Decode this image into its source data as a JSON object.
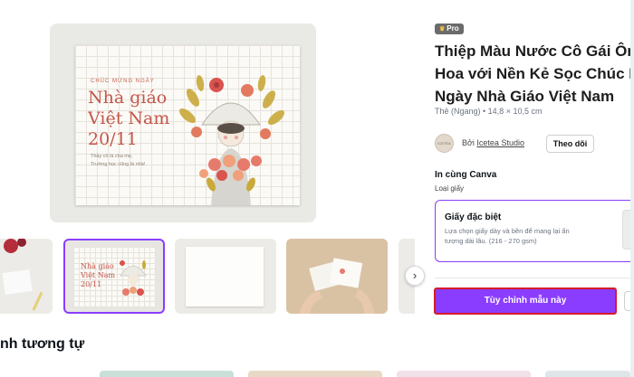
{
  "preview": {
    "small_title": "CHÚC MỪNG NGÀY",
    "line1": "Nhà giáo",
    "line2": "Việt Nam",
    "line3": "20/11",
    "sub1": "Thầy cô là cha mẹ,",
    "sub2": "Trường học cũng là nhà!"
  },
  "thumbnails": {
    "selected_line1": "Nhà giáo",
    "selected_line2": "Việt Nam",
    "selected_line3": "20/11",
    "next_icon": "chevron-right-icon",
    "next_glyph": "›"
  },
  "similar": {
    "title": "nh tương tự"
  },
  "details": {
    "badge": "Pro",
    "badge_icon": "crown-icon",
    "title_lines": [
      "Thiệp Màu Nước Cô Gái Ôm",
      "Hoa với Nền Kẻ Sọc Chúc M",
      "Ngày Nhà Giáo Việt Nam"
    ],
    "meta": "Thẻ (Ngang) • 14,8 × 10,5 cm",
    "avatar_text": "ICETEA",
    "by_label": "Bởi",
    "author": "Icetea Studio",
    "follow_label": "Theo dõi",
    "print_title": "In cùng Canva",
    "paper_type_label": "Loại giấy",
    "paper_option": {
      "title": "Giấy đặc biệt",
      "desc1": "Lựa chọn giấy dày và bền để mang lại ấn",
      "desc2": "tượng dài lâu. (216 - 270 gsm)"
    },
    "cta_label": "Tùy chỉnh mẫu này",
    "star_icon": "star-icon",
    "star_glyph": "☆"
  },
  "colors": {
    "accent": "#8b3dff",
    "highlight_border": "#d61a2c",
    "card_text": "#c5564a"
  }
}
